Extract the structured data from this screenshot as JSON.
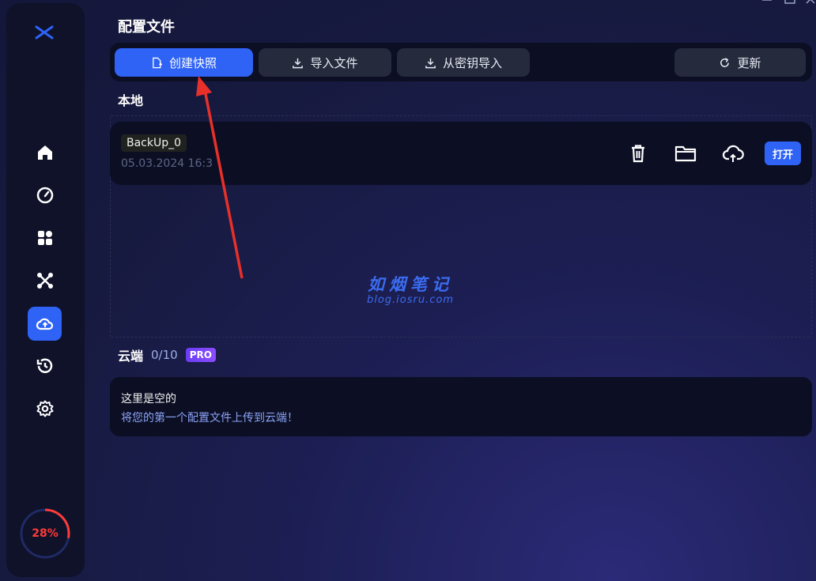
{
  "window": {
    "title": "配置文件"
  },
  "sidebar": {
    "items": [
      {
        "name": "home",
        "icon": "home-icon",
        "active": false
      },
      {
        "name": "performance",
        "icon": "speedometer-icon",
        "active": false
      },
      {
        "name": "apps",
        "icon": "grid-icon",
        "active": false
      },
      {
        "name": "tools",
        "icon": "network-icon",
        "active": false
      },
      {
        "name": "profiles",
        "icon": "cloud-upload-icon",
        "active": true
      },
      {
        "name": "history",
        "icon": "history-icon",
        "active": false
      },
      {
        "name": "settings",
        "icon": "gear-icon",
        "active": false
      }
    ],
    "gauge": {
      "label": "28%",
      "value": 0.28,
      "color": "#ff3b3b"
    }
  },
  "toolbar": {
    "create_snapshot": "创建快照",
    "import_file": "导入文件",
    "import_from_key": "从密钥导入",
    "refresh": "更新"
  },
  "local": {
    "title": "本地",
    "backups": [
      {
        "name": "BackUp_0",
        "date": "05.03.2024 16:3",
        "open_label": "打开"
      }
    ]
  },
  "watermark": {
    "main": "如烟笔记",
    "sub": "blog.iosru.com"
  },
  "cloud": {
    "title": "云端",
    "count": "0/10",
    "badge": "PRO",
    "empty_title": "这里是空的",
    "empty_desc": "将您的第一个配置文件上传到云端！"
  },
  "colors": {
    "accent": "#2f63f5",
    "card": "#0c0f24",
    "sidebar": "#0f1228"
  }
}
